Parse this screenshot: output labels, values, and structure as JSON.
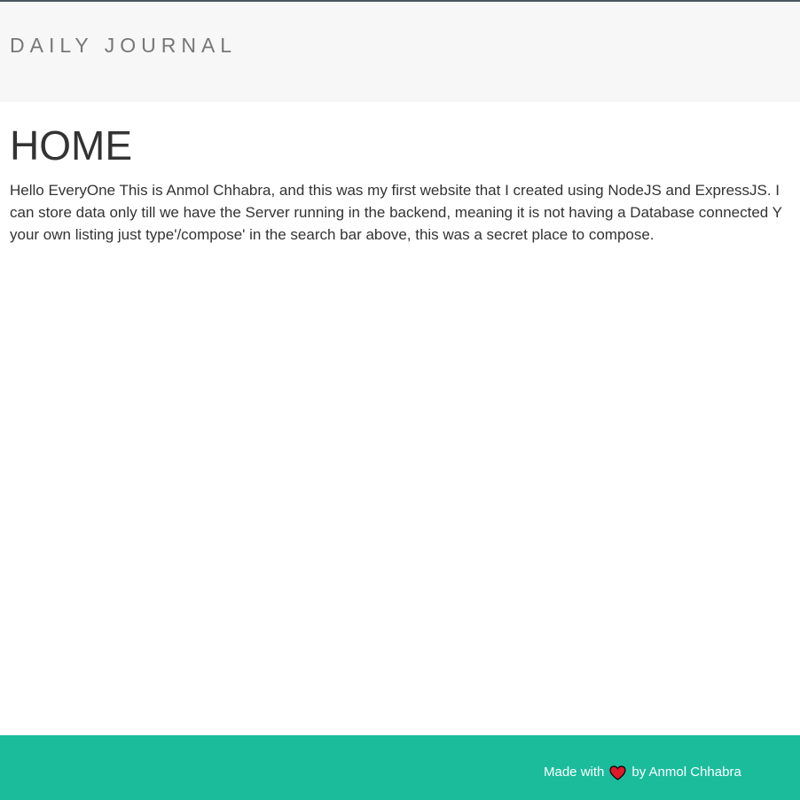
{
  "navbar": {
    "brand": "DAILY JOURNAL"
  },
  "main": {
    "title": "HOME",
    "content_lines": [
      "Hello EveryOne This is Anmol Chhabra, and this was my first website that I created using NodeJS and ExpressJS. I",
      "can store data only till we have the Server running in the backend, meaning it is not having a Database connected Y",
      "your own listing just type'/compose' in the search bar above, this was a secret place to compose."
    ]
  },
  "footer": {
    "made_with": "Made with",
    "heart_icon": "heart-icon",
    "by": "by Anmol Chhabra"
  },
  "colors": {
    "footer_bg": "#1abc9c",
    "navbar_bg": "#f7f7f7",
    "heart": "#e0192b"
  }
}
